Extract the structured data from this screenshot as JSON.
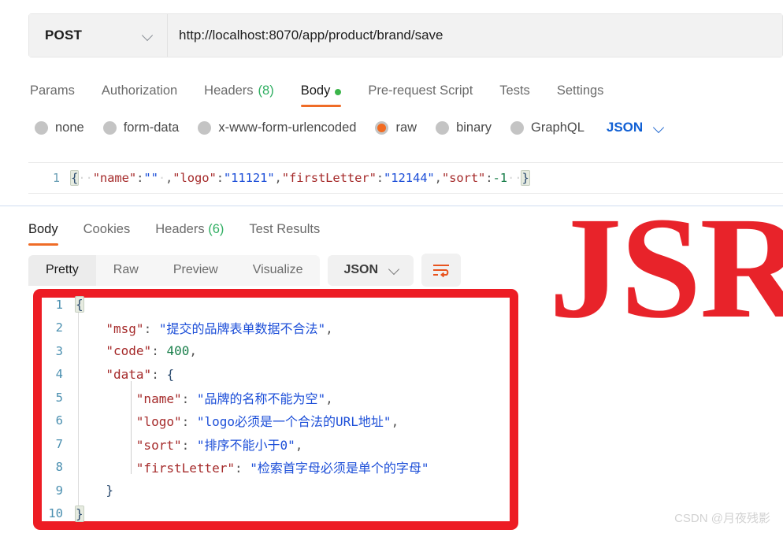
{
  "request": {
    "method": "POST",
    "url": "http://localhost:8070/app/product/brand/save",
    "method_chevron_icon": "chevron-down-icon",
    "tabs": [
      {
        "label": "Params",
        "active": false
      },
      {
        "label": "Authorization",
        "active": false
      },
      {
        "label": "Headers",
        "count": "(8)",
        "active": false
      },
      {
        "label": "Body",
        "active": true,
        "dot": true
      },
      {
        "label": "Pre-request Script",
        "active": false
      },
      {
        "label": "Tests",
        "active": false
      },
      {
        "label": "Settings",
        "active": false
      }
    ],
    "body_types": [
      {
        "label": "none",
        "selected": false
      },
      {
        "label": "form-data",
        "selected": false
      },
      {
        "label": "x-www-form-urlencoded",
        "selected": false
      },
      {
        "label": "raw",
        "selected": true
      },
      {
        "label": "binary",
        "selected": false
      },
      {
        "label": "GraphQL",
        "selected": false
      }
    ],
    "raw_format": "JSON",
    "editor": {
      "line_number": "1",
      "open_brace": "{",
      "key_name": "\"name\"",
      "colon": ":",
      "val_name": "\"\"",
      "comma1": ",",
      "key_logo": "\"logo\"",
      "val_logo": "\"11121\"",
      "comma2": ",",
      "key_first": "\"firstLetter\"",
      "val_first": "\"12144\"",
      "comma3": ",",
      "key_sort": "\"sort\"",
      "val_sort": "-1",
      "close_brace": "}"
    }
  },
  "response": {
    "tabs": [
      {
        "label": "Body",
        "active": true
      },
      {
        "label": "Cookies",
        "active": false
      },
      {
        "label": "Headers",
        "count": "(6)",
        "active": false
      },
      {
        "label": "Test Results",
        "active": false
      }
    ],
    "view_tabs": [
      {
        "label": "Pretty",
        "active": true
      },
      {
        "label": "Raw",
        "active": false
      },
      {
        "label": "Preview",
        "active": false
      },
      {
        "label": "Visualize",
        "active": false
      }
    ],
    "format": "JSON",
    "format_chevron_icon": "chevron-down-icon",
    "wrap_icon": "word-wrap-icon",
    "body_lines": [
      {
        "no": "1",
        "indent": 0,
        "tokens": [
          {
            "t": "{",
            "c": "brk-hl"
          }
        ]
      },
      {
        "no": "2",
        "indent": 4,
        "tokens": [
          {
            "t": "\"msg\"",
            "c": "k"
          },
          {
            "t": ": ",
            "c": "p"
          },
          {
            "t": "\"提交的品牌表单数据不合法\"",
            "c": "s"
          },
          {
            "t": ",",
            "c": "p"
          }
        ]
      },
      {
        "no": "3",
        "indent": 4,
        "tokens": [
          {
            "t": "\"code\"",
            "c": "k"
          },
          {
            "t": ": ",
            "c": "p"
          },
          {
            "t": "400",
            "c": "n"
          },
          {
            "t": ",",
            "c": "p"
          }
        ]
      },
      {
        "no": "4",
        "indent": 4,
        "tokens": [
          {
            "t": "\"data\"",
            "c": "k"
          },
          {
            "t": ": ",
            "c": "p"
          },
          {
            "t": "{",
            "c": "brk"
          }
        ]
      },
      {
        "no": "5",
        "indent": 8,
        "tokens": [
          {
            "t": "\"name\"",
            "c": "k"
          },
          {
            "t": ": ",
            "c": "p"
          },
          {
            "t": "\"品牌的名称不能为空\"",
            "c": "s"
          },
          {
            "t": ",",
            "c": "p"
          }
        ]
      },
      {
        "no": "6",
        "indent": 8,
        "tokens": [
          {
            "t": "\"logo\"",
            "c": "k"
          },
          {
            "t": ": ",
            "c": "p"
          },
          {
            "t": "\"logo必须是一个合法的URL地址\"",
            "c": "s"
          },
          {
            "t": ",",
            "c": "p"
          }
        ]
      },
      {
        "no": "7",
        "indent": 8,
        "tokens": [
          {
            "t": "\"sort\"",
            "c": "k"
          },
          {
            "t": ": ",
            "c": "p"
          },
          {
            "t": "\"排序不能小于0\"",
            "c": "s"
          },
          {
            "t": ",",
            "c": "p"
          }
        ]
      },
      {
        "no": "8",
        "indent": 8,
        "tokens": [
          {
            "t": "\"firstLetter\"",
            "c": "k"
          },
          {
            "t": ": ",
            "c": "p"
          },
          {
            "t": "\"检索首字母必须是单个的字母\"",
            "c": "s"
          }
        ]
      },
      {
        "no": "9",
        "indent": 4,
        "tokens": [
          {
            "t": "}",
            "c": "brk"
          }
        ]
      },
      {
        "no": "10",
        "indent": 0,
        "tokens": [
          {
            "t": "}",
            "c": "brk-hl"
          }
        ]
      }
    ],
    "parsed_json": {
      "msg": "提交的品牌表单数据不合法",
      "code": 400,
      "data": {
        "name": "品牌的名称不能为空",
        "logo": "logo必须是一个合法的URL地址",
        "sort": "排序不能小于0",
        "firstLetter": "检索首字母必须是单个的字母"
      }
    }
  },
  "annotations": {
    "highlight_box_color": "#ed1c24",
    "watermark_text": "JSR",
    "watermark_color": "#e8232a",
    "credit": "CSDN @月夜残影"
  },
  "colors": {
    "accent_orange": "#ef6c27",
    "link_blue": "#1160d4",
    "green": "#2fae61",
    "json_key": "#a52a2a",
    "json_string": "#1d4fd8",
    "json_number": "#1a7f4b"
  }
}
